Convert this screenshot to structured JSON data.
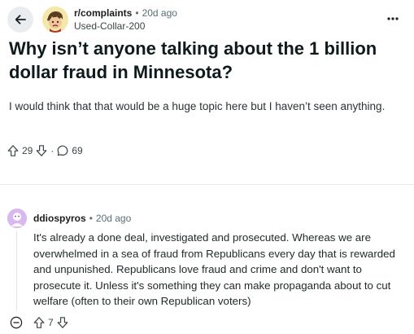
{
  "post": {
    "subreddit": "r/complaints",
    "separator": "•",
    "age": "20d ago",
    "author": "Used-Collar-200",
    "title": "Why isn’t anyone talking about the 1 billion dollar fraud in Minnesota?",
    "body": "I would think that that would be a huge topic here but I haven’t seen anything.",
    "upvotes": "29",
    "action_separator": "·",
    "comments": "69"
  },
  "comment": {
    "author": "ddiospyros",
    "separator": "•",
    "age": "20d ago",
    "body": "It's already a done deal, investigated and prosecuted. Whereas we are overwhelmed in a sea of fraud from Republicans every day that is rewarded and unpunished. Republicans love fraud and crime and don't want to prosecute it. Unless it's something they can make propaganda about to cut welfare (often to their own Republican voters)",
    "upvotes": "7"
  },
  "icons": {
    "back": "arrow-left-icon",
    "more": "ellipsis-icon",
    "upvote": "arrow-up-icon",
    "downvote": "arrow-down-icon",
    "comments": "speech-bubble-icon",
    "collapse": "minus-circle-icon"
  },
  "colors": {
    "subreddit_avatar_bg": "#f5e7a8",
    "comment_avatar_bg": "#d9b8ef",
    "back_button_bg": "#eaedef",
    "muted_text": "#576f76"
  }
}
